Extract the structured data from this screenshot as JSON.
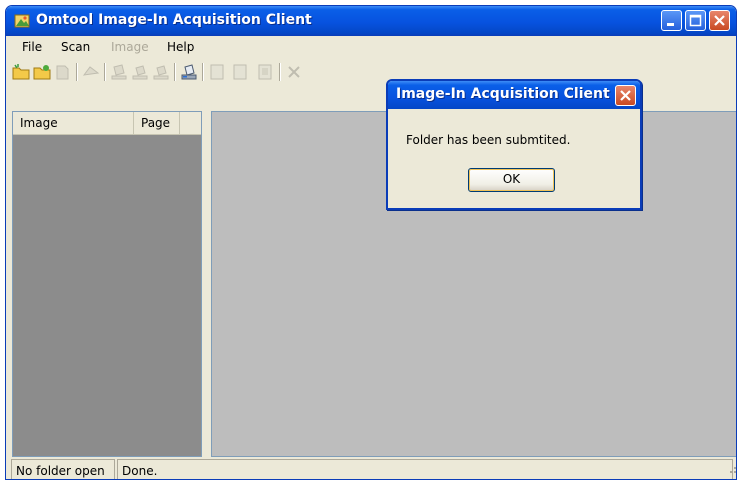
{
  "window": {
    "title": "Omtool Image-In Acquisition Client"
  },
  "menubar": {
    "items": [
      {
        "label": "File",
        "enabled": true
      },
      {
        "label": "Scan",
        "enabled": true
      },
      {
        "label": "Image",
        "enabled": false
      },
      {
        "label": "Help",
        "enabled": true
      }
    ]
  },
  "toolbar": {
    "icons": [
      "new-folder-icon",
      "open-folder-icon",
      "close-folder-icon",
      "submit-icon",
      "scan-icon",
      "scan-append-icon",
      "scan-insert-icon",
      "scanner-settings-icon",
      "page-icon",
      "page-insert-icon",
      "page-replace-icon",
      "delete-icon"
    ]
  },
  "list": {
    "columns": [
      "Image",
      "Page"
    ]
  },
  "statusbar": {
    "folder_status": "No folder open",
    "message": "Done."
  },
  "dialog": {
    "title": "Image-In Acquisition Client",
    "message": "Folder has been submtited.",
    "ok_label": "OK"
  },
  "colors": {
    "title_bar": "#0752df",
    "dialog_border": "#0a3cb8",
    "list_background": "#8c8c8c",
    "viewer_background": "#bdbdbd",
    "chrome": "#ece9d8"
  }
}
